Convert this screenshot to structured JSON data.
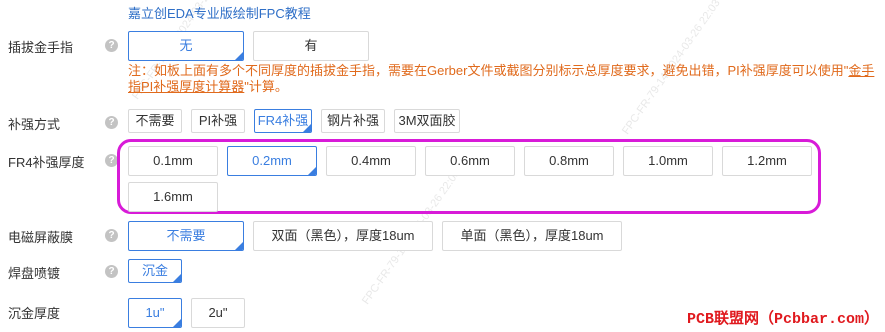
{
  "header": {
    "link_text": "嘉立创EDA专业版绘制FPC教程"
  },
  "rows": {
    "gold_finger": {
      "label": "插拔金手指",
      "options": [
        "无",
        "有"
      ],
      "selected": "无"
    },
    "note": {
      "text": "注：如板上面有多个不同厚度的插拔金手指，需要在Gerber文件或截图分别标示总厚度要求，避免出错，PI补强厚度可以使用\"",
      "link1": "金手指PI补强厚度计算器",
      "suffix": "\"计算。"
    },
    "stiffener_type": {
      "label": "补强方式",
      "options": [
        "不需要",
        "PI补强",
        "FR4补强",
        "钢片补强",
        "3M双面胶"
      ],
      "selected": "FR4补强"
    },
    "fr4_thickness": {
      "label": "FR4补强厚度",
      "options": [
        "0.1mm",
        "0.2mm",
        "0.4mm",
        "0.6mm",
        "0.8mm",
        "1.0mm",
        "1.2mm",
        "1.6mm"
      ],
      "selected": "0.2mm"
    },
    "emi_film": {
      "label": "电磁屏蔽膜",
      "options": [
        "不需要",
        "双面（黑色），厚度18um",
        "单面（黑色），厚度18um"
      ],
      "selected": "不需要"
    },
    "pad_plating": {
      "label": "焊盘喷镀",
      "options": [
        "沉金"
      ],
      "selected": "沉金"
    },
    "gold_thickness": {
      "label": "沉金厚度",
      "options": [
        "1u\"",
        "2u\""
      ],
      "selected": "1u\""
    }
  },
  "help_icon_char": "?",
  "brand": "PCB联盟网（Pcbbar.com）",
  "watermark": "FPC-FR-79-14 2024-03-26 22:03",
  "colors": {
    "accent": "#3a7ee0",
    "note": "#e06a1c",
    "highlight_frame": "#d81bd8",
    "brand": "#e0191e"
  }
}
